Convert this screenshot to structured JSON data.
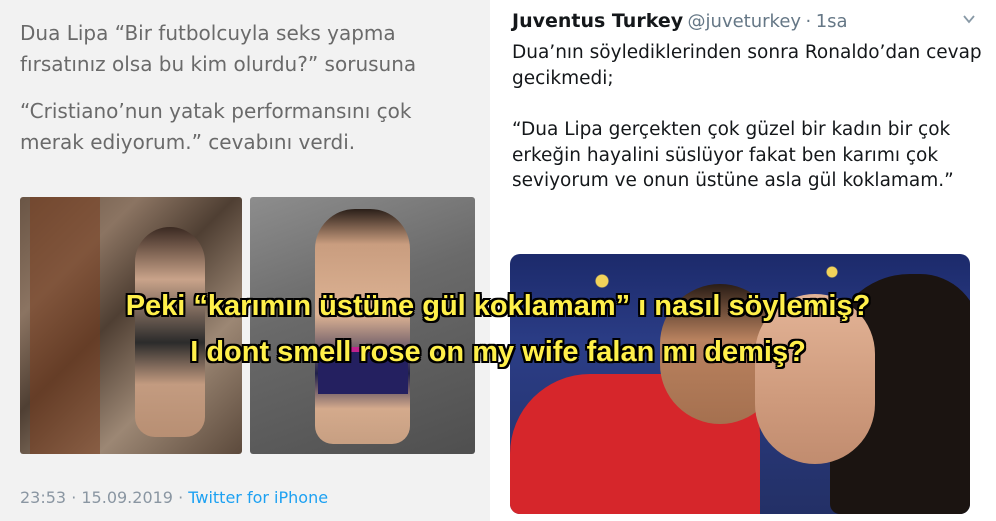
{
  "left_tweet": {
    "paragraph1": "Dua Lipa “Bir futbolcuyla seks yapma fırsatınız olsa bu kim olurdu?” sorusuna",
    "paragraph2": "“Cristiano’nun yatak performansını çok merak ediyorum.” cevabını verdi.",
    "timestamp": "23:53 · 15.09.2019 ·",
    "source": "Twitter for iPhone"
  },
  "right_tweet": {
    "name": "Juventus Turkey",
    "handle": "@juveturkey",
    "separator": "·",
    "time": "1sa",
    "paragraph1": "Dua’nın söylediklerinden sonra Ronaldo’dan cevap gecikmedi;",
    "paragraph2": "“Dua Lipa gerçekten çok güzel bir kadın bir çok erkeğin hayalini süslüyor fakat ben karımı çok seviyorum ve onun üstüne asla gül koklamam.”",
    "icon": "chevron-down-icon"
  },
  "caption": {
    "line1": "Peki “karımın üstüne gül koklamam” ı nasıl söylemiş?",
    "line2": "I dont smell rose on my wife falan mı demiş?",
    "color": "#fff04a"
  },
  "colors": {
    "twitter_blue": "#1da1f2",
    "muted_gray": "#657786"
  }
}
